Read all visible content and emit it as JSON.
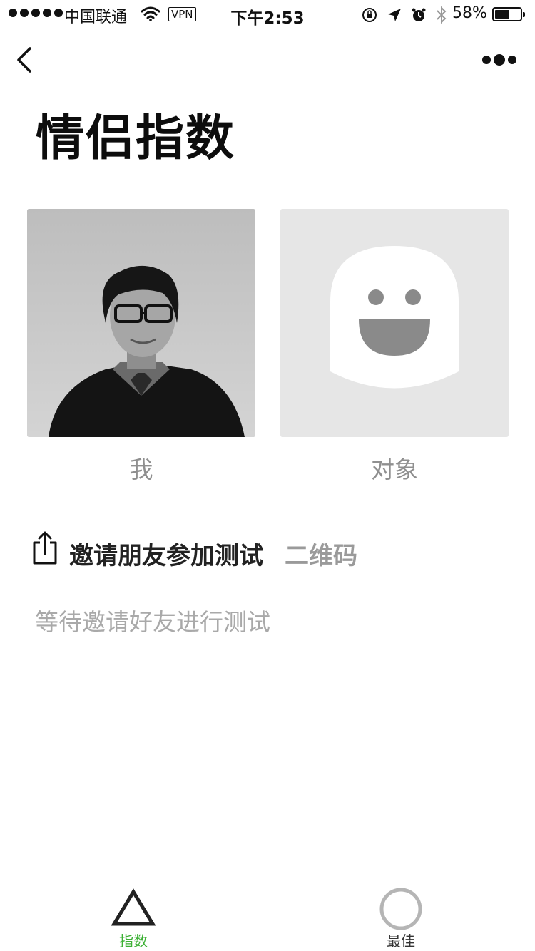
{
  "status_bar": {
    "carrier": "中国联通",
    "vpn": "VPN",
    "time": "下午2:53",
    "battery_percent": "58%",
    "battery_level": 0.58
  },
  "page": {
    "title": "情侣指数"
  },
  "profiles": {
    "me_label": "我",
    "partner_label": "对象"
  },
  "invite": {
    "label": "邀请朋友参加测试",
    "qrcode_label": "二维码",
    "waiting_text": "等待邀请好友进行测试"
  },
  "tab_bar": {
    "items": [
      {
        "label": "指数",
        "color": "#3cb034"
      },
      {
        "label": "最佳",
        "color": "#333333"
      }
    ]
  },
  "colors": {
    "accent": "#3cb034"
  }
}
